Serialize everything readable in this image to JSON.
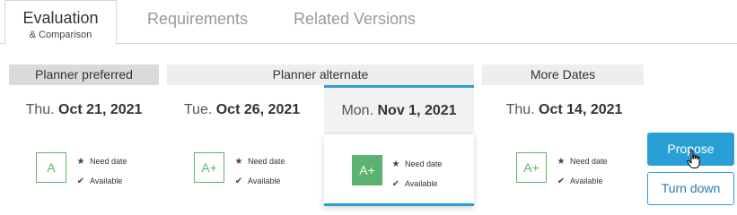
{
  "tabs": [
    {
      "label": "Evaluation",
      "sublabel": "& Comparison",
      "active": true
    },
    {
      "label": "Requirements",
      "active": false
    },
    {
      "label": "Related Versions",
      "active": false
    }
  ],
  "groups": {
    "preferred": "Planner preferred",
    "alternate": "Planner alternate",
    "more": "More Dates"
  },
  "columns": [
    {
      "weekday": "Thu.",
      "date": "Oct 21, 2021",
      "grade": "A",
      "need": "Need date",
      "available": "Available"
    },
    {
      "weekday": "Tue.",
      "date": "Oct 26, 2021",
      "grade": "A+",
      "need": "Need date",
      "available": "Available"
    },
    {
      "weekday": "Mon.",
      "date": "Nov 1, 2021",
      "grade": "A+",
      "need": "Need date",
      "available": "Available",
      "selected": true
    },
    {
      "weekday": "Thu.",
      "date": "Oct 14, 2021",
      "grade": "A+",
      "need": "Need date",
      "available": "Available"
    }
  ],
  "actions": {
    "propose": "Propose",
    "turn_down": "Turn down"
  },
  "colors": {
    "accent": "#2a9fd6",
    "grade": "#5cb270"
  },
  "icons": {
    "need": "star-icon",
    "available": "check-icon",
    "cursor": "hand-pointer-icon"
  }
}
